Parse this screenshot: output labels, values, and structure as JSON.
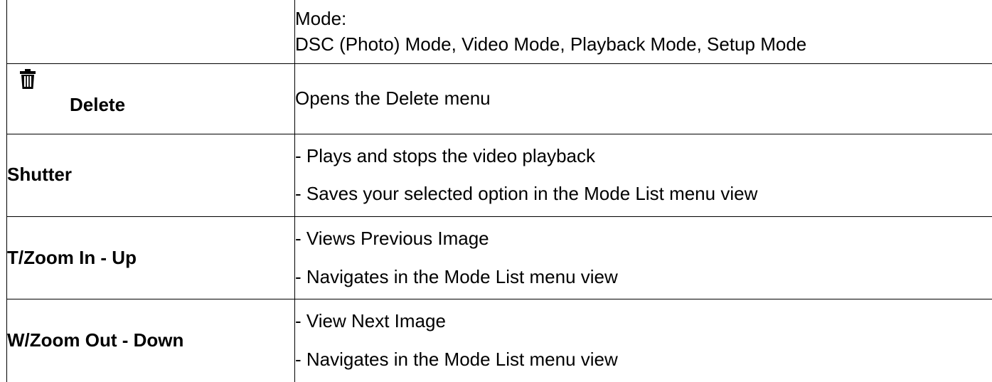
{
  "rows": [
    {
      "button": "",
      "description": [
        "Mode:",
        "DSC (Photo) Mode, Video Mode, Playback Mode, Setup Mode"
      ]
    },
    {
      "button": "Delete",
      "icon": "trash-icon",
      "description": [
        "Opens the Delete menu"
      ]
    },
    {
      "button": "Shutter",
      "description": [
        "- Plays and stops the video playback",
        "- Saves your selected option in the Mode List menu view"
      ]
    },
    {
      "button": "T/Zoom In - Up",
      "description": [
        "- Views Previous Image",
        "- Navigates in the Mode List menu view"
      ]
    },
    {
      "button": "W/Zoom Out - Down",
      "description": [
        "- View Next Image",
        "- Navigates in the Mode List menu view"
      ]
    }
  ]
}
